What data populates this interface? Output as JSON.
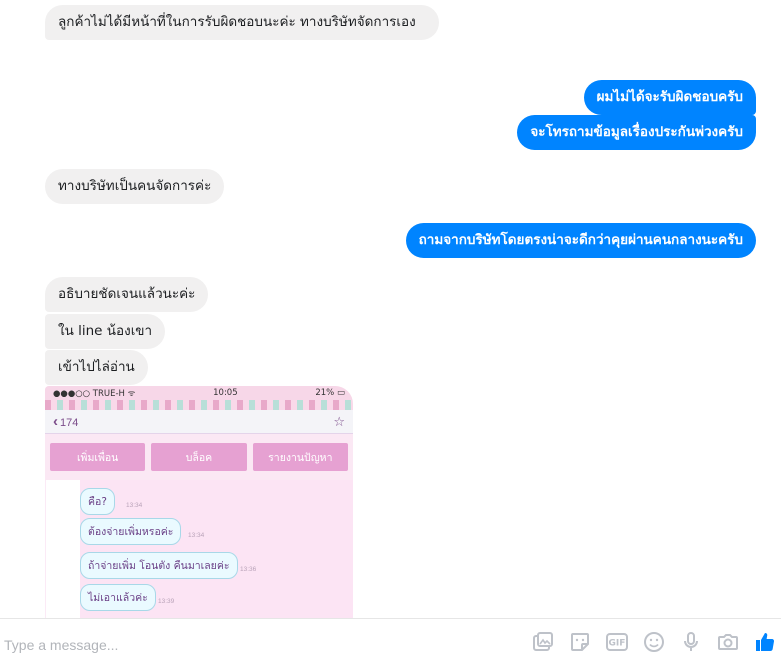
{
  "messages": {
    "m1": "ลูกค้าไม่ได้มีหน้าที่ในการรับผิดชอบนะค่ะ ทางบริษัทจัดการเอง",
    "m2": "ผมไม่ได้จะรับผิดชอบครับ",
    "m3": "จะโทรถามข้อมูลเรื่องประกันพ่วงครับ",
    "m4": "ทางบริษัทเป็นคนจัดการค่ะ",
    "m5": "ถามจากบริษัทโดยตรงน่าจะดีกว่าคุยผ่านคนกลางนะครับ",
    "m6": "อธิบายชัดเจนแล้วนะค่ะ",
    "m7": "ใน line น้องเขา",
    "m8": "เข้าไปไล่อ่าน"
  },
  "attachment": {
    "carrier": "●●●○○ TRUE-H ᯤ",
    "time": "10:05",
    "battery": "21% ▭",
    "back_count": "174",
    "buttons": [
      "เพิ่มเพื่อน",
      "บล็อค",
      "รายงานปัญหา"
    ],
    "chat": [
      {
        "text": "คือ?",
        "time": "13:34"
      },
      {
        "text": "ต้องจ่ายเพิ่มหรอค่ะ",
        "time": "13:34"
      },
      {
        "text": "ถ้าจ่ายเพิ่ม โอนตัง คืนมาเลยค่ะ",
        "time": "13:36"
      },
      {
        "text": "ไม่เอาแล้วค่ะ",
        "time": "13:39"
      }
    ]
  },
  "composer": {
    "placeholder": "Type a message..."
  },
  "colors": {
    "outgoing": "#0084ff",
    "incoming": "#f1f0f0",
    "like": "#0084ff",
    "tool_icons": "#bec2c9"
  },
  "icons": [
    "image-icon",
    "sticker-icon",
    "gif-icon",
    "emoji-icon",
    "microphone-icon",
    "camera-icon",
    "like-icon"
  ]
}
